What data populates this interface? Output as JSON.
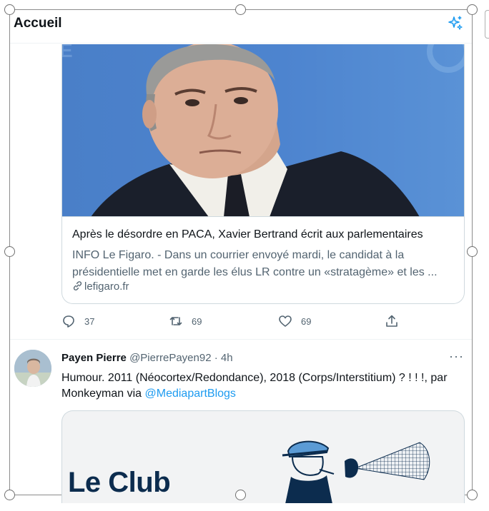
{
  "header": {
    "title": "Accueil",
    "sparkle_icon": "sparkle-icon"
  },
  "tweet1": {
    "card": {
      "title": "Après le désordre en PACA, Xavier Bertrand écrit aux parlementaires",
      "description": "INFO Le Figaro. - Dans un courrier envoyé mardi, le candidat à la présidentielle met en garde les élus LR contre un «stratagème» et les ...",
      "domain": "lefigaro.fr"
    },
    "actions": {
      "replies": "37",
      "retweets": "69",
      "likes": "69"
    }
  },
  "tweet2": {
    "name": "Payen Pierre",
    "handle": "@PierrePayen92 · 4h",
    "more": "···",
    "text_before": "Humour. 2011 (Néocortex/Redondance), 2018 (Corps/Interstitium) ? ! ! !, par Monkeyman via ",
    "mention": "@MediapartBlogs",
    "card": {
      "headline": "Le Club"
    }
  },
  "colors": {
    "accent": "#1d9bf0",
    "muted": "#536471",
    "border": "#cfd9de",
    "club": "#0c2c4e"
  }
}
